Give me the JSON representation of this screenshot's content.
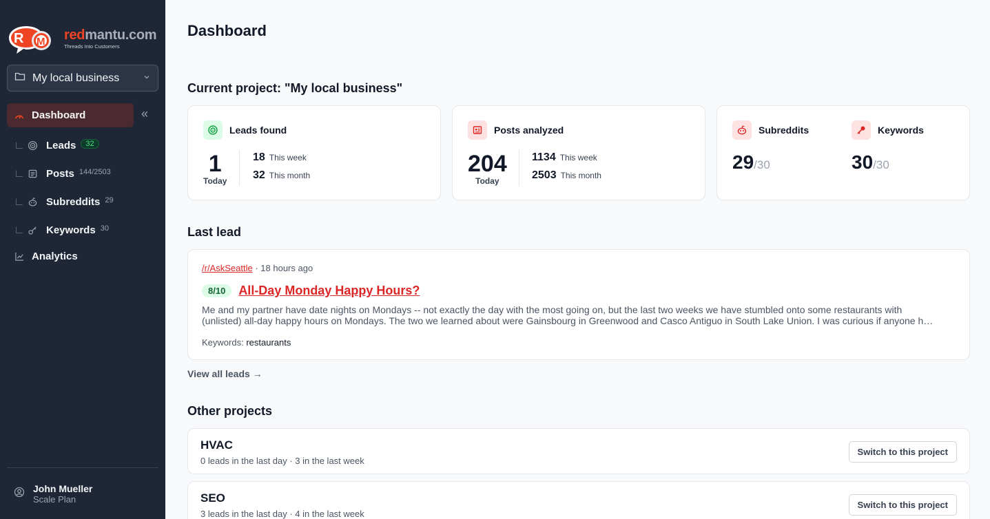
{
  "brand": {
    "name_red": "red",
    "name_grey": "mantu.com",
    "tagline": "Threads Into Customers",
    "logo_letters": "R M"
  },
  "project_select": {
    "label": "My local business"
  },
  "nav": {
    "dashboard": "Dashboard",
    "leads": {
      "label": "Leads",
      "badge": "32"
    },
    "posts": {
      "label": "Posts",
      "count": "144/2503"
    },
    "subreddits": {
      "label": "Subreddits",
      "count": "29"
    },
    "keywords": {
      "label": "Keywords",
      "count": "30"
    },
    "analytics": "Analytics",
    "collapse": "«"
  },
  "user": {
    "name": "John Mueller",
    "plan": "Scale Plan"
  },
  "page_title": "Dashboard",
  "current_project_title": "Current project: \"My local business\"",
  "stats": {
    "leads": {
      "title": "Leads found",
      "today": "1",
      "today_label": "Today",
      "week": "18",
      "week_label": "This week",
      "month": "32",
      "month_label": "This month"
    },
    "posts": {
      "title": "Posts analyzed",
      "today": "204",
      "today_label": "Today",
      "week": "1134",
      "week_label": "This week",
      "month": "2503",
      "month_label": "This month"
    },
    "subreddits": {
      "title": "Subreddits",
      "value": "29",
      "max": "/30"
    },
    "keywords": {
      "title": "Keywords",
      "value": "30",
      "max": "/30"
    }
  },
  "last_lead_title": "Last lead",
  "last_lead": {
    "subreddit": "/r/AskSeattle",
    "sep": "·",
    "time": "18 hours ago",
    "score": "8/10",
    "title": "All-Day Monday Happy Hours?",
    "body_1": "Me and my partner have date nights on Mondays -- not exactly the day with the most going on, but the last two weeks we have stumbled onto some restaurants with",
    "body_2": "(unlisted) all-day happy hours on Mondays. The two we learned about were Gainsbourg in Greenwood and Casco Antiguo in South Lake Union. I was curious if anyone h…",
    "keywords_label": "Keywords:",
    "keywords": "restaurants"
  },
  "view_all": "View all leads →",
  "other_projects_title": "Other projects",
  "projects": [
    {
      "name": "HVAC",
      "stats": "0 leads in the last day · 3 in the last week",
      "button": "Switch to this project"
    },
    {
      "name": "SEO",
      "stats": "3 leads in the last day · 4 in the last week",
      "button": "Switch to this project"
    }
  ],
  "colors": {
    "sidebar": "#1f2737",
    "accent": "#dc2626",
    "active_nav": "#4a2a30",
    "badge_green": "#4ade80"
  }
}
